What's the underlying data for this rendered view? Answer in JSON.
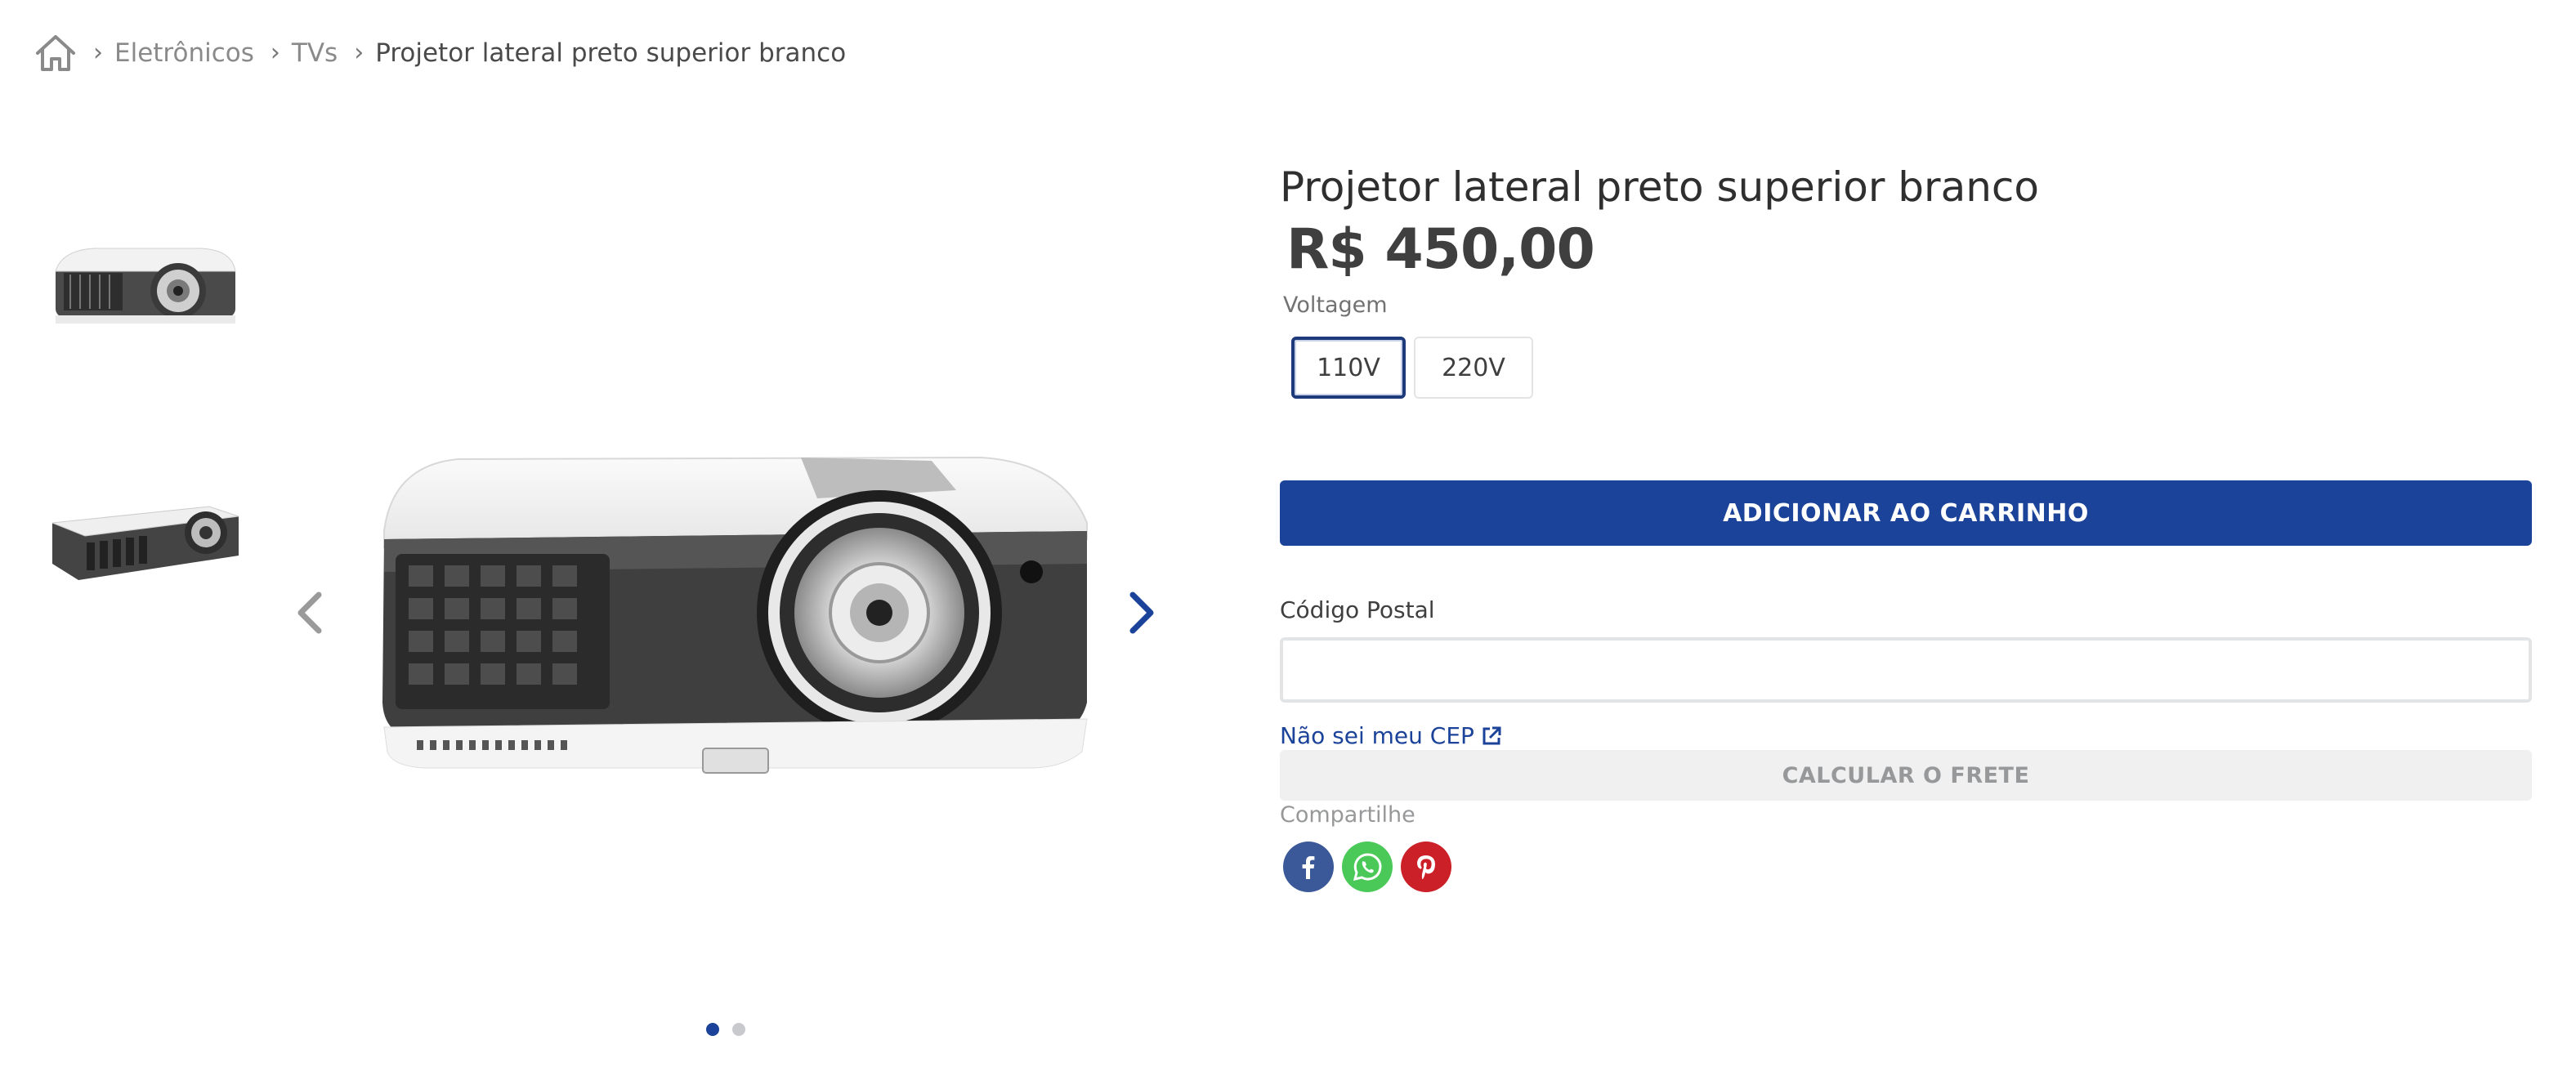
{
  "breadcrumb": {
    "home_icon": "home-icon",
    "items": [
      {
        "label": "Eletrônicos"
      },
      {
        "label": "TVs"
      }
    ],
    "current": "Projetor lateral preto superior branco"
  },
  "gallery": {
    "thumbnails": [
      "projector-front-thumbnail",
      "projector-side-thumbnail"
    ],
    "prev_icon": "chevron-left-icon",
    "next_icon": "chevron-right-icon",
    "dots": [
      {
        "active": true
      },
      {
        "active": false
      }
    ]
  },
  "product": {
    "title": "Projetor lateral preto superior branco",
    "price": "R$ 450,00",
    "voltage_label": "Voltagem",
    "voltage_options": [
      {
        "label": "110V",
        "selected": true
      },
      {
        "label": "220V",
        "selected": false
      }
    ],
    "add_to_cart": "ADICIONAR AO CARRINHO",
    "postal_label": "Código Postal",
    "postal_value": "",
    "cep_link": "Não sei meu CEP",
    "calc_shipping": "CALCULAR O FRETE",
    "share_label": "Compartilhe",
    "share": [
      {
        "icon": "facebook-icon",
        "color": "#3b5998"
      },
      {
        "icon": "whatsapp-icon",
        "color": "#4ac959"
      },
      {
        "icon": "pinterest-icon",
        "color": "#cb2027"
      }
    ]
  },
  "colors": {
    "primary": "#1b4399",
    "text": "#3f3f40",
    "muted": "#979899",
    "border": "#e3e4e6"
  }
}
